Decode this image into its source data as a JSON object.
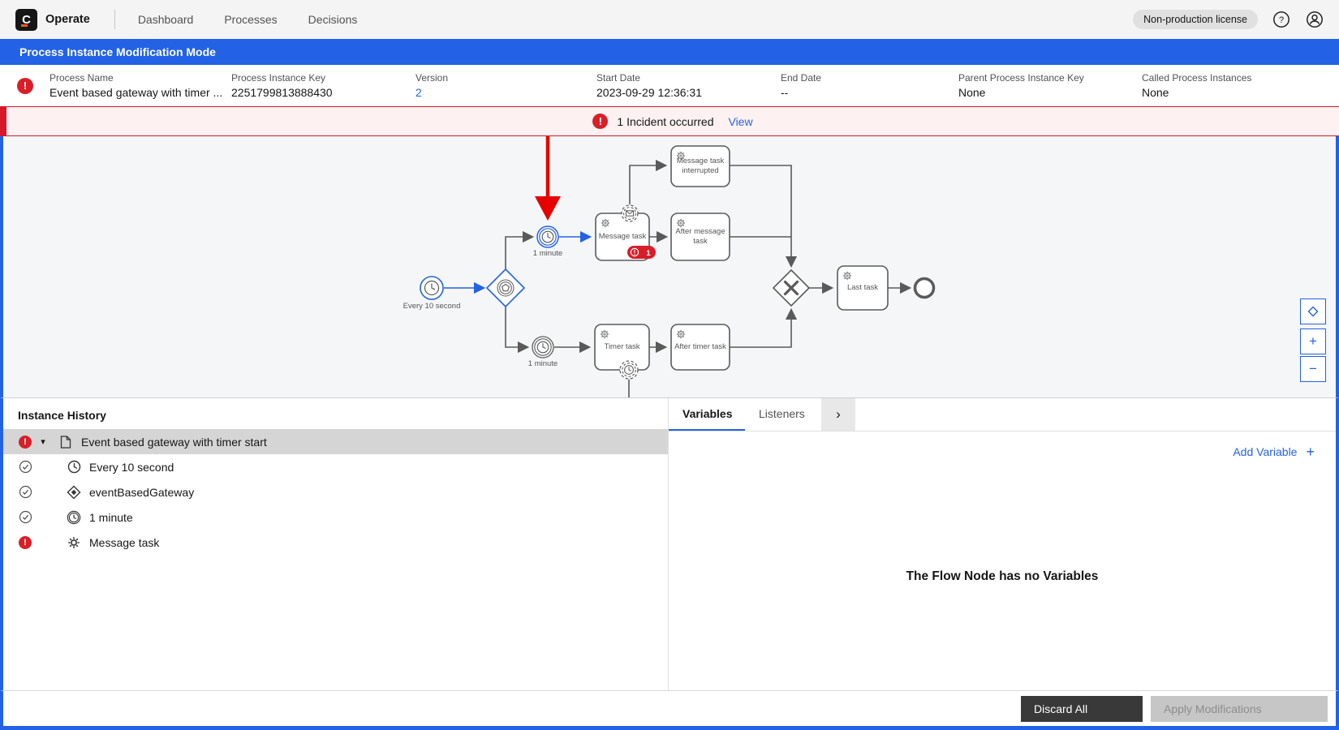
{
  "colors": {
    "accent_blue": "#2362e4",
    "incident_red": "#da1e28",
    "incident_bar_bg": "#fef1f1",
    "modification_arrow_red": "#e60000",
    "camunda_orange": "#fc5d0d"
  },
  "topbar": {
    "logo_letter": "C",
    "app_name": "Operate",
    "nav": [
      {
        "label": "Dashboard"
      },
      {
        "label": "Processes"
      },
      {
        "label": "Decisions"
      }
    ],
    "license_badge": "Non-production license",
    "icons": [
      "help-icon",
      "user-icon"
    ]
  },
  "modification_banner": {
    "title": "Process Instance Modification Mode"
  },
  "instance_header": {
    "fields": [
      {
        "label": "Process Name",
        "value": "Event based gateway with timer ..."
      },
      {
        "label": "Process Instance Key",
        "value": "2251799813888430"
      },
      {
        "label": "Version",
        "value": "2"
      },
      {
        "label": "Start Date",
        "value": "2023-09-29 12:36:31"
      },
      {
        "label": "End Date",
        "value": "--"
      },
      {
        "label": "Parent Process Instance Key",
        "value": "None"
      },
      {
        "label": "Called Process Instances",
        "value": "None"
      }
    ]
  },
  "incident_banner": {
    "message": "1 Incident occurred",
    "action": "View"
  },
  "diagram": {
    "labels": {
      "start_event": "Every 10 second",
      "timer_upper": "1 minute",
      "timer_lower": "1 minute",
      "message_task": "Message task",
      "message_task_interrupted": "Message task interrupted",
      "after_message_task": "After message task",
      "timer_task": "Timer task",
      "after_timer_task": "After timer task",
      "last_task": "Last task"
    },
    "incident_badge_count": "1",
    "zoom_controls": {
      "zoom_in": "+",
      "zoom_out": "−"
    }
  },
  "history": {
    "title": "Instance History",
    "rows": [
      {
        "state": "incident",
        "icon": "process-instance",
        "label": "Event based gateway with timer start"
      },
      {
        "state": "completed",
        "icon": "timer-start-event",
        "label": "Every 10 second"
      },
      {
        "state": "completed",
        "icon": "event-based-gateway",
        "label": "eventBasedGateway"
      },
      {
        "state": "completed",
        "icon": "timer-catch-event",
        "label": "1 minute"
      },
      {
        "state": "incident",
        "icon": "service-task",
        "label": "Message task"
      }
    ]
  },
  "panel": {
    "tabs": [
      {
        "label": "Variables"
      },
      {
        "label": "Listeners"
      }
    ],
    "add_variable_label": "Add Variable",
    "empty_message": "The Flow Node has no Variables"
  },
  "footer": {
    "discard_label": "Discard All",
    "apply_label": "Apply Modifications"
  }
}
